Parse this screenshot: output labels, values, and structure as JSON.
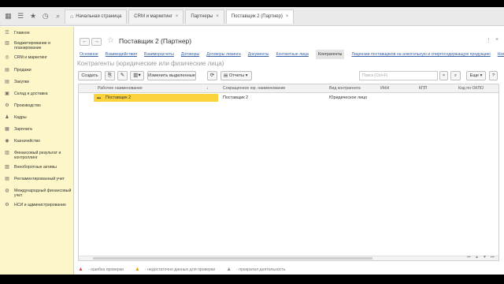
{
  "topbar": {
    "tabs": [
      {
        "label": "Начальная страница",
        "active": false,
        "home": true
      },
      {
        "label": "CRM и маркетинг",
        "active": false
      },
      {
        "label": "Партнеры",
        "active": false
      },
      {
        "label": "Поставщик 2 (Партнер)",
        "active": true
      }
    ]
  },
  "sidebar": {
    "items": [
      {
        "label": "Главное",
        "icon": "hamburger-icon"
      },
      {
        "label": "Бюджетирование и планирование",
        "icon": "chart-icon"
      },
      {
        "label": "CRM и маркетинг",
        "icon": "crm-icon"
      },
      {
        "label": "Продажи",
        "icon": "cart-icon"
      },
      {
        "label": "Закупки",
        "icon": "cart-icon"
      },
      {
        "label": "Склад и доставка",
        "icon": "box-icon"
      },
      {
        "label": "Производство",
        "icon": "factory-icon"
      },
      {
        "label": "Кадры",
        "icon": "people-icon"
      },
      {
        "label": "Зарплата",
        "icon": "salary-icon"
      },
      {
        "label": "Казначейство",
        "icon": "bank-icon"
      },
      {
        "label": "Финансовый результат и контроллинг",
        "icon": "chart-icon"
      },
      {
        "label": "Внеоборотные активы",
        "icon": "asset-icon"
      },
      {
        "label": "Регламентированный учет",
        "icon": "report-icon"
      },
      {
        "label": "Международный финансовый учет",
        "icon": "globe-icon"
      },
      {
        "label": "НСИ и администрирование",
        "icon": "gear-icon"
      }
    ]
  },
  "header": {
    "title": "Поставщик 2 (Партнер)",
    "back": "←",
    "forward": "→",
    "more": "⋮",
    "close": "×"
  },
  "links": [
    {
      "label": "Основное",
      "current": false
    },
    {
      "label": "Взаимодействия",
      "current": false
    },
    {
      "label": "Взаиморасчеты",
      "current": false
    },
    {
      "label": "Договоры",
      "current": false
    },
    {
      "label": "Договоры лизинга",
      "current": false
    },
    {
      "label": "Документы",
      "current": false
    },
    {
      "label": "Контактные лица",
      "current": false
    },
    {
      "label": "Контрагенты",
      "current": true
    },
    {
      "label": "Лицензии поставщиков на алкогольную и спиртосодержащую продукцию",
      "current": false
    },
    {
      "label": "Номенклатура",
      "current": false
    }
  ],
  "subtitle": "Контрагенты (юридические или физические лица)",
  "toolbar": {
    "create": "Создать",
    "edit_selected": "Изменить выделенные",
    "reports": "Отчеты",
    "search_placeholder": "Поиск (Ctrl+F)",
    "more": "Еще",
    "help": "?"
  },
  "table": {
    "headers": [
      "Рабочее наименование",
      "Сокращенное юр. наименование",
      "Вид контрагента",
      "ИНН",
      "КПП",
      "Код по ОКПО"
    ],
    "rows": [
      [
        "Поставщик 2",
        "Поставщик 2",
        "Юридическое лицо",
        "",
        "",
        ""
      ]
    ],
    "sort_indicator": "↓"
  },
  "status": {
    "items": [
      {
        "label": "- ошибка проверки",
        "kind": "error"
      },
      {
        "label": "- недостаточно данных для проверки",
        "kind": "warning"
      },
      {
        "label": "- прекратил деятельность",
        "kind": "stopped"
      }
    ]
  },
  "colors": {
    "sidebar_bg": "#fdf6c8",
    "selection": "#fcd33a",
    "link": "#3a62a7"
  }
}
